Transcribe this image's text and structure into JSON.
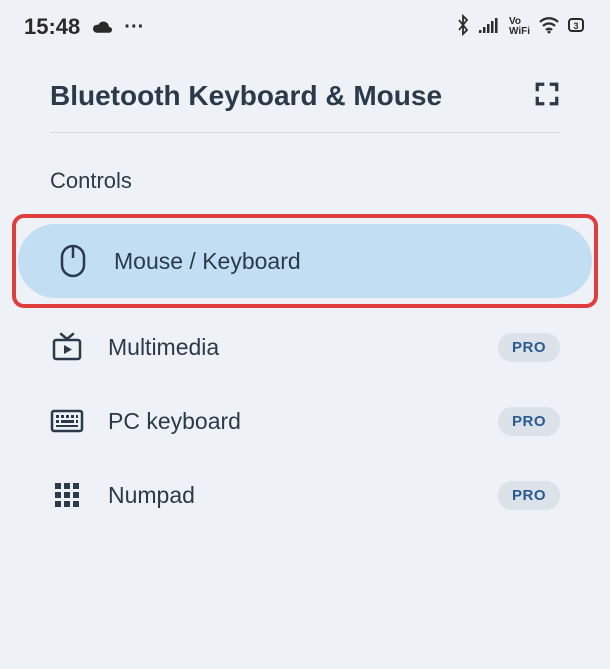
{
  "status": {
    "time": "15:48"
  },
  "header": {
    "title": "Bluetooth Keyboard & Mouse"
  },
  "section": {
    "label": "Controls"
  },
  "items": [
    {
      "label": "Mouse / Keyboard",
      "selected": true,
      "highlighted": true
    },
    {
      "label": "Multimedia",
      "badge": "PRO"
    },
    {
      "label": "PC keyboard",
      "badge": "PRO"
    },
    {
      "label": "Numpad",
      "badge": "PRO"
    }
  ]
}
